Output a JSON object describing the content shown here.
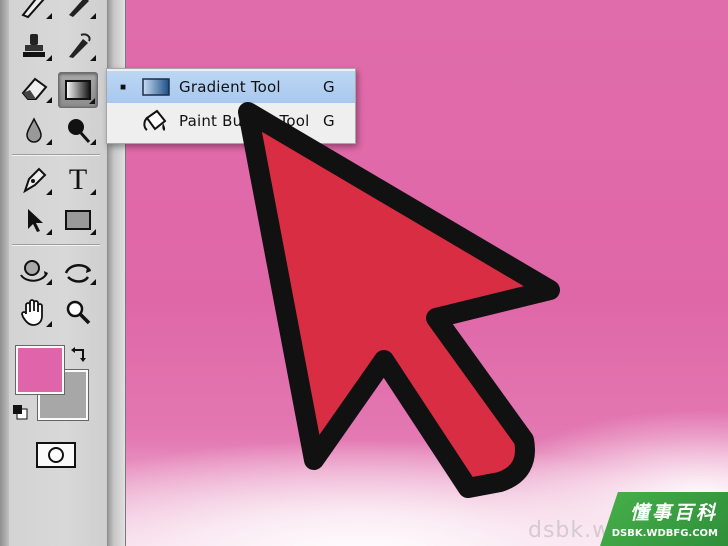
{
  "menu": {
    "items": [
      {
        "label": "Gradient Tool",
        "shortcut": "G",
        "selected": true,
        "bullet": "■"
      },
      {
        "label": "Paint Bucket Tool",
        "shortcut": "G",
        "selected": false,
        "bullet": ""
      }
    ]
  },
  "toolbar": {
    "type_tool_glyph": "T"
  },
  "colors": {
    "foreground": "#e064a9",
    "background": "#a7a7a7",
    "canvas": "#e06aa8",
    "arrow_fill": "#d92d43",
    "selection": "#b3d0f2"
  },
  "watermark": {
    "brand": "懂事百科",
    "url": "DSBK.WDBFG.COM",
    "faint": "dsbk.wdbfg.com"
  }
}
